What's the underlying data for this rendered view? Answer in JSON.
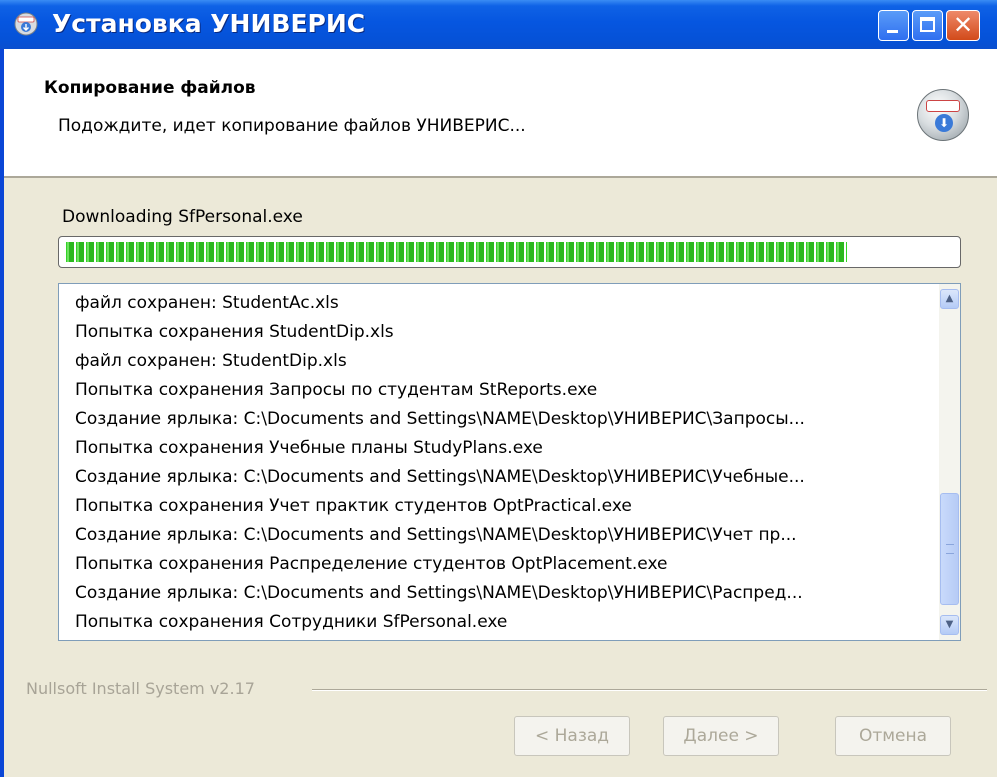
{
  "window": {
    "title": "Установка УНИВЕРИС",
    "controls": {
      "minimize": "minimize",
      "maximize": "maximize",
      "close": "✕"
    }
  },
  "header": {
    "title": "Копирование файлов",
    "subtitle": "Подождите, идет копирование файлов УНИВЕРИС..."
  },
  "status": {
    "label": "Downloading SfPersonal.exe",
    "progress_fraction": 0.88
  },
  "log": {
    "lines": [
      "файл сохранен: StudentAc.xls",
      "Попытка сохранения StudentDip.xls",
      "файл сохранен: StudentDip.xls",
      "Попытка сохранения Запросы по студентам StReports.exe",
      "Создание ярлыка: C:\\Documents and Settings\\NAME\\Desktop\\УНИВЕРИС\\Запросы...",
      "Попытка сохранения Учебные планы StudyPlans.exe",
      "Создание ярлыка: C:\\Documents and Settings\\NAME\\Desktop\\УНИВЕРИС\\Учебные...",
      "Попытка сохранения Учет практик студентов OptPractical.exe",
      "Создание ярлыка: C:\\Documents and Settings\\NAME\\Desktop\\УНИВЕРИС\\Учет пр...",
      "Попытка сохранения Распределение студентов OptPlacement.exe",
      "Создание ярлыка: C:\\Documents and Settings\\NAME\\Desktop\\УНИВЕРИС\\Распред...",
      "Попытка сохранения Сотрудники SfPersonal.exe"
    ]
  },
  "branding": "Nullsoft Install System v2.17",
  "buttons": {
    "back": "< Назад",
    "next": "Далее >",
    "cancel": "Отмена"
  },
  "icons": {
    "title": "installer-icon",
    "header": "install-logo-icon",
    "scroll_up": "▲",
    "scroll_down": "▼"
  }
}
